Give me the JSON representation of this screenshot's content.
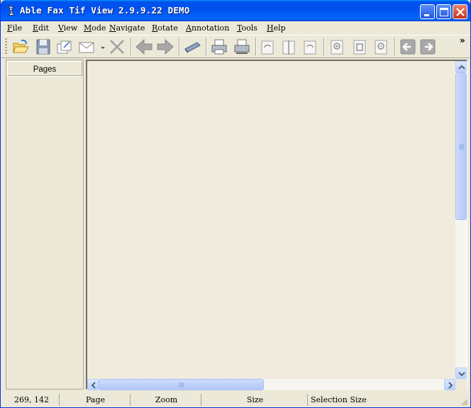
{
  "window": {
    "title": "Able Fax Tif View 2.9.9.22 DEMO",
    "icons": [
      "app-icon",
      "minimize-icon",
      "maximize-icon",
      "close-icon"
    ]
  },
  "menu": {
    "items": [
      "File",
      "Edit",
      "View",
      "Mode",
      "Navigate",
      "Rotate",
      "Annotation",
      "Tools",
      "Help"
    ]
  },
  "toolbar": {
    "overflow_label": "»",
    "icons": [
      "open-folder-icon",
      "save-icon",
      "batch-icon",
      "email-icon",
      "delete-icon",
      "back-arrow-icon",
      "forward-arrow-icon",
      "scan-icon",
      "print-icon",
      "print-setup-icon",
      "rotate-left-icon",
      "flip-icon",
      "rotate-right-icon",
      "zoom-in-icon",
      "zoom-fit-icon",
      "zoom-out-icon",
      "previous-page-icon",
      "next-page-icon"
    ]
  },
  "pages_panel": {
    "header": "Pages"
  },
  "statusbar": {
    "coords": "269, 142",
    "page": "Page",
    "zoom": "Zoom",
    "size": "Size",
    "selection_size": "Selection Size"
  },
  "colors": {
    "title_blue": "#0054e3",
    "canvas_bg": "#f0ebdd",
    "chrome_bg": "#ece9d8",
    "close_red": "#d5432c"
  }
}
